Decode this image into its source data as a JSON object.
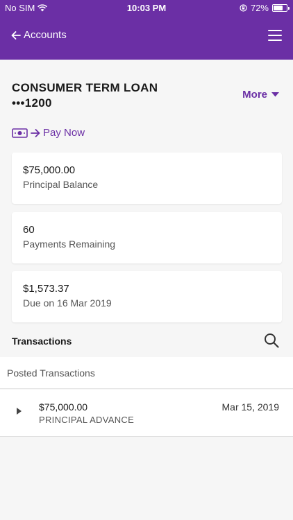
{
  "status_bar": {
    "carrier": "No SIM",
    "time": "10:03 PM",
    "battery": "72%",
    "battery_level": 0.72
  },
  "nav": {
    "back_label": "Accounts",
    "menu_icon": "hamburger-menu-icon"
  },
  "account": {
    "title": "CONSUMER TERM LOAN",
    "number": "•••1200",
    "more_label": "More",
    "pay_now_label": "Pay Now"
  },
  "cards": [
    {
      "value": "$75,000.00",
      "label": "Principal Balance"
    },
    {
      "value": "60",
      "label": "Payments Remaining"
    },
    {
      "value": "$1,573.37",
      "label": "Due on 16 Mar 2019"
    }
  ],
  "transactions": {
    "header": "Transactions",
    "section_label": "Posted Transactions",
    "items": [
      {
        "amount": "$75,000.00",
        "description": "PRINCIPAL ADVANCE",
        "date": "Mar 15, 2019"
      }
    ]
  },
  "colors": {
    "brand": "#6b2fa5",
    "background": "#f6f6f6"
  }
}
